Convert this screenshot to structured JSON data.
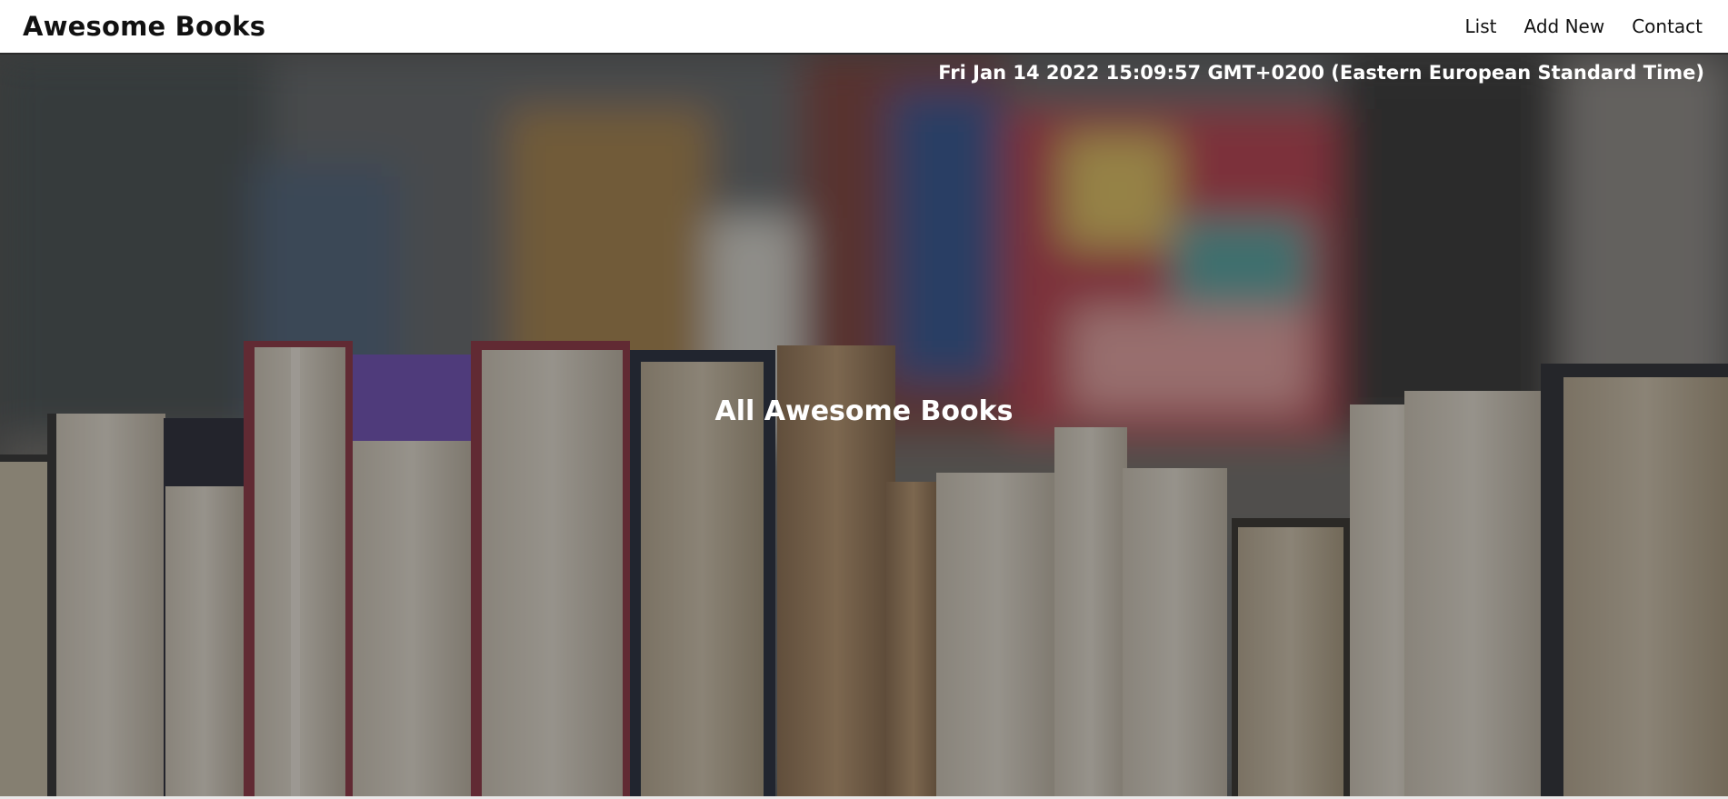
{
  "header": {
    "brand": "Awesome Books",
    "nav": [
      {
        "label": "List"
      },
      {
        "label": "Add New"
      },
      {
        "label": "Contact"
      }
    ]
  },
  "hero": {
    "datetime": "Fri Jan 14 2022 15:09:57 GMT+0200 (Eastern European Standard Time)",
    "title": "All Awesome Books",
    "background_image": "books-on-shelf-photo"
  },
  "colors": {
    "header_bg": "#ffffff",
    "header_text": "#111111",
    "hero_text": "#ffffff"
  }
}
